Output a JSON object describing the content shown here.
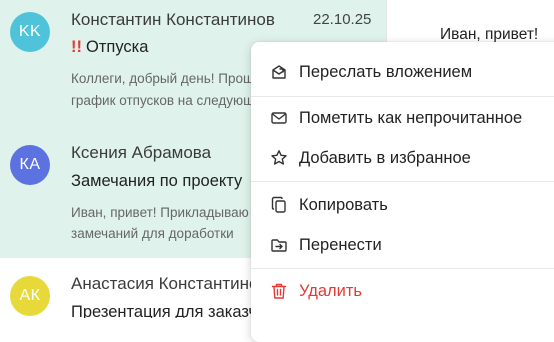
{
  "mail_list": [
    {
      "avatar_initials": "KK",
      "avatar_color": "#4fc3d9",
      "sender": "Константин Константинов",
      "date": "22.10.25",
      "priority_mark": "!!",
      "subject": "Отпуска",
      "snippet_line1": "Коллеги, добрый день! Прошу ознакомиться",
      "snippet_line2": "график отпусков на следующий год"
    },
    {
      "avatar_initials": "КА",
      "avatar_color": "#5c72e0",
      "sender": "Ксения Абрамова",
      "subject": "Замечания по проекту",
      "snippet_line1": "Иван, привет! Прикладываю список",
      "snippet_line2": "замечаний для доработки"
    },
    {
      "avatar_initials": "АК",
      "avatar_color": "#e8d93a",
      "sender": "Анастасия Константинова",
      "subject": "Презентация для заказчика"
    }
  ],
  "preview": {
    "greeting": "Иван, привет!"
  },
  "context_menu": {
    "forward_as_attachment": "Переслать вложением",
    "mark_unread": "Пометить как непрочитанное",
    "add_favorite": "Добавить в избранное",
    "copy": "Копировать",
    "move": "Перенести",
    "delete": "Удалить"
  },
  "colors": {
    "selected_row": "#dff3ec",
    "danger": "#e53935"
  }
}
